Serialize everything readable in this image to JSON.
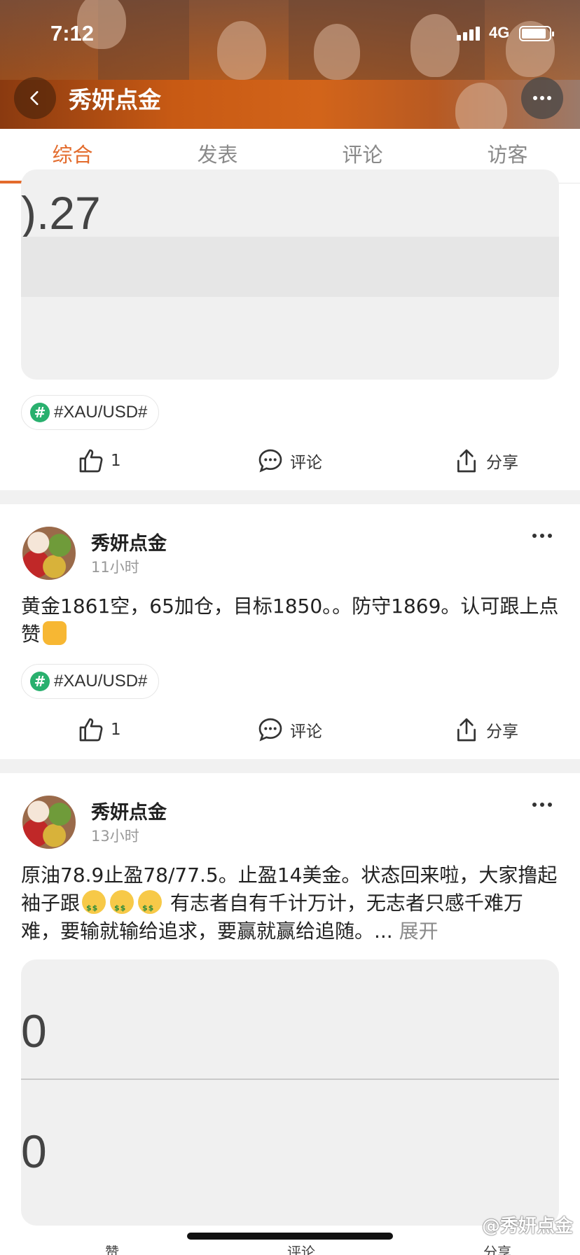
{
  "status": {
    "time": "7:12",
    "network": "4G"
  },
  "header": {
    "title": "秀妍点金"
  },
  "tabs": [
    "综合",
    "发表",
    "评论",
    "访客"
  ],
  "posts": [
    {
      "image_text": ").27",
      "tag": "#XAU/USD#",
      "likes": "1",
      "comment_label": "评论",
      "share_label": "分享"
    },
    {
      "author": "秀妍点金",
      "time": "11小时",
      "text": "黄金1861空，65加仓，目标1850。。防守1869。认可跟上点赞",
      "tag": "#XAU/USD#",
      "likes": "1",
      "comment_label": "评论",
      "share_label": "分享"
    },
    {
      "author": "秀妍点金",
      "time": "13小时",
      "text_a": "原油78.9止盈78/77.5。止盈14美金。状态回来啦，大家撸起袖子跟",
      "text_b": " 有志者自有千计万计，无志者只感千难万难，要输就输给追求，要赢就赢给追随。... ",
      "expand": "展开",
      "image_text_1": "0",
      "image_text_2": "0",
      "action_like": "赞",
      "action_comment": "评论",
      "action_share": "分享"
    }
  ],
  "watermark": "@秀妍点金"
}
